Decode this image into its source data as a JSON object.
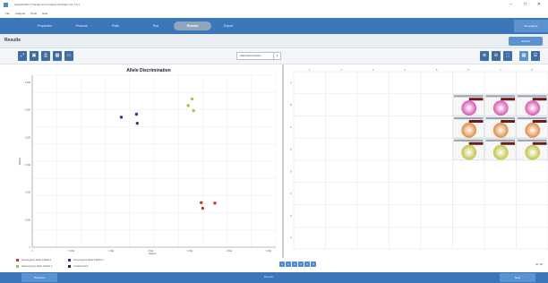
{
  "window": {
    "title": "QuantStudio™ Design and Analysis Software  Ver 1.5.1"
  },
  "menu": [
    "File",
    "Analysis",
    "Tools",
    "Help"
  ],
  "nav": {
    "tabs": [
      {
        "label": "Properties"
      },
      {
        "label": "Protocol"
      },
      {
        "label": "Plate"
      },
      {
        "label": "Run"
      },
      {
        "label": "Results",
        "active": true
      },
      {
        "label": "Export"
      }
    ],
    "right_button": "Re-analyze"
  },
  "results": {
    "title": "Results",
    "action": "Actions"
  },
  "toolbar": {
    "dropdown_value": "Allele Discrimination"
  },
  "chart": {
    "title": "Allele Discrimination",
    "xlabel": "Allele1",
    "ylabel": "Allele2",
    "y_ticks": [
      "3.00E",
      "2.50E",
      "2.00E",
      "1.50E",
      "1.00E",
      "5.00E",
      "0"
    ],
    "x_ticks": [
      "0",
      "5.00E",
      "1.00E",
      "1.50E",
      "2.00E",
      "2.50E",
      "3.00E"
    ]
  },
  "chart_data": {
    "type": "scatter",
    "title": "Allele Discrimination",
    "xlabel": "Allele1",
    "ylabel": "Allele2",
    "xlim": [
      0,
      3.2
    ],
    "ylim": [
      0,
      3.4
    ],
    "series": [
      {
        "name": "Homozygous Allele 1",
        "color": "#cc3333",
        "points": [
          [
            2.22,
            0.88
          ],
          [
            2.24,
            0.77
          ],
          [
            2.4,
            0.87
          ]
        ]
      },
      {
        "name": "Homozygous Allele 2",
        "color": "#2b3a9a",
        "points": [
          [
            1.17,
            2.57
          ],
          [
            1.37,
            2.63
          ],
          [
            1.38,
            2.45
          ]
        ]
      },
      {
        "name": "Heterozygous",
        "color": "#a4c43d",
        "points": [
          [
            2.05,
            2.8
          ],
          [
            2.1,
            2.93
          ],
          [
            2.12,
            2.7
          ]
        ]
      }
    ]
  },
  "legend": [
    {
      "label": "Homozygous Allele 1/Allele 1",
      "color": "#cc3333"
    },
    {
      "label": "Homozygous Allele 2/Allele 2",
      "color": "#2b3a9a"
    },
    {
      "label": "Heterozygous Allele 1/Allele 2",
      "color": "#a4c43d"
    },
    {
      "label": "Undetermined",
      "color": "#2a2a2a"
    }
  ],
  "plate": {
    "columns": [
      "1",
      "2",
      "3",
      "4",
      "5",
      "6",
      "7",
      "8"
    ],
    "rows": [
      "A",
      "B",
      "C",
      "D",
      "E",
      "F",
      "G",
      "H"
    ],
    "filled": [
      {
        "row": 1,
        "col": 5,
        "color": "#d955b3"
      },
      {
        "row": 1,
        "col": 6,
        "color": "#d955b3"
      },
      {
        "row": 1,
        "col": 7,
        "color": "#d955b3"
      },
      {
        "row": 2,
        "col": 5,
        "color": "#e08a3e"
      },
      {
        "row": 2,
        "col": 6,
        "color": "#e08a3e"
      },
      {
        "row": 2,
        "col": 7,
        "color": "#e08a3e"
      },
      {
        "row": 3,
        "col": 5,
        "color": "#c4c445"
      },
      {
        "row": 3,
        "col": 6,
        "color": "#c4c445"
      },
      {
        "row": 3,
        "col": 7,
        "color": "#c4c445"
      }
    ]
  },
  "pagination": [
    "1",
    "2",
    "3",
    "4",
    "5",
    "6"
  ],
  "status_right": "96 / 96",
  "footer": {
    "left": "Previous",
    "center": "Results",
    "right": "Next"
  }
}
